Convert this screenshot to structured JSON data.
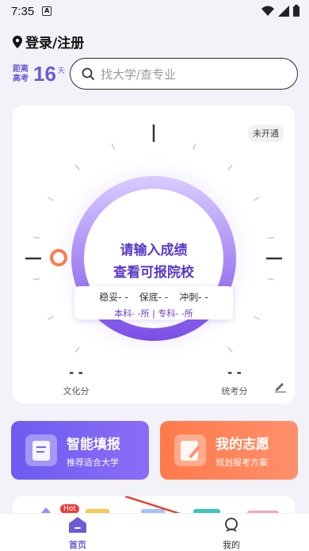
{
  "status_bar": {
    "time": "7:35",
    "notification_icon": "A"
  },
  "header": {
    "login_label": "登录/注册"
  },
  "countdown": {
    "label_line1": "距离",
    "label_line2": "高考",
    "days": "16",
    "unit": "天"
  },
  "search": {
    "placeholder": "找大学/查专业"
  },
  "score_card": {
    "badge": "未开通",
    "prompt_line1": "请输入成绩",
    "prompt_line2": "查看可报院校",
    "stats": {
      "stable": "稳妥- -",
      "safe": "保底- -",
      "reach": "冲刺- -"
    },
    "sub_stats": "本科- -所  |  专科- -所",
    "culture_score": "- -",
    "culture_label": "文化分",
    "unified_score": "- -",
    "unified_label": "统考分"
  },
  "tiles": [
    {
      "title": "智能填报",
      "subtitle": "推荐适合大学"
    },
    {
      "title": "我的志愿",
      "subtitle": "规划报考方案"
    }
  ],
  "strip": {
    "hot_badge": "Hot"
  },
  "tabbar": {
    "home": "首页",
    "mine": "我的"
  },
  "colors": {
    "accent": "#6b5bd6",
    "orange": "#ff7a4a"
  }
}
